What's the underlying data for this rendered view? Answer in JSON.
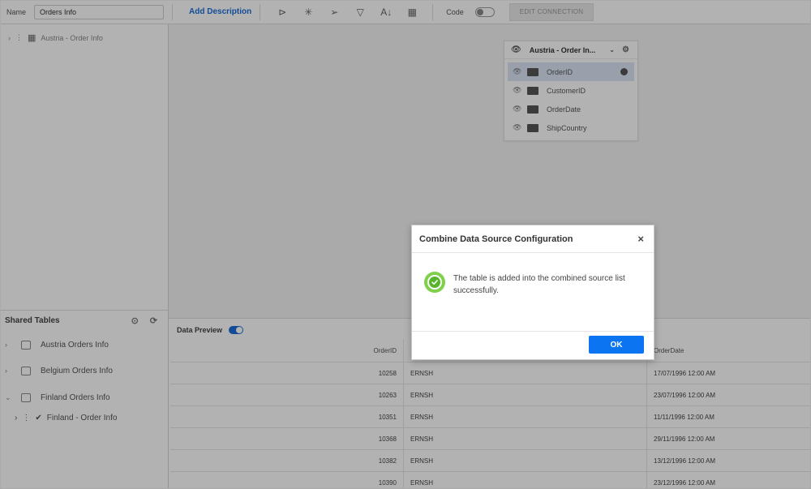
{
  "toolbar": {
    "name_label": "Name",
    "name_value": "Orders Info",
    "add_description": "Add Description",
    "code_label": "Code",
    "edit_connection": "EDIT CONNECTION"
  },
  "left_panel": {
    "tree_root": "Austria - Order Info",
    "shared_tables_title": "Shared Tables",
    "shared_tables": [
      {
        "label": "Austria Orders Info"
      },
      {
        "label": "Belgium Orders Info"
      },
      {
        "label": "Finland Orders Info"
      }
    ],
    "sub_item": "Finland - Order Info"
  },
  "canvas": {
    "table_card": {
      "title": "Austria - Order In...",
      "columns": [
        "OrderID",
        "CustomerID",
        "OrderDate",
        "ShipCountry"
      ]
    }
  },
  "preview": {
    "title": "Data Preview",
    "headers": [
      "OrderID",
      "",
      "OrderDate"
    ],
    "rows": [
      [
        "10258",
        "ERNSH",
        "17/07/1996 12:00 AM"
      ],
      [
        "10263",
        "ERNSH",
        "23/07/1996 12:00 AM"
      ],
      [
        "10351",
        "ERNSH",
        "11/11/1996 12:00 AM"
      ],
      [
        "10368",
        "ERNSH",
        "29/11/1996 12:00 AM"
      ],
      [
        "10382",
        "ERNSH",
        "13/12/1996 12:00 AM"
      ],
      [
        "10390",
        "ERNSH",
        "23/12/1996 12:00 AM"
      ]
    ]
  },
  "dialog": {
    "title": "Combine Data Source Configuration",
    "message": "The table is added into the combined source list successfully.",
    "ok_label": "OK",
    "close_glyph": "×"
  }
}
